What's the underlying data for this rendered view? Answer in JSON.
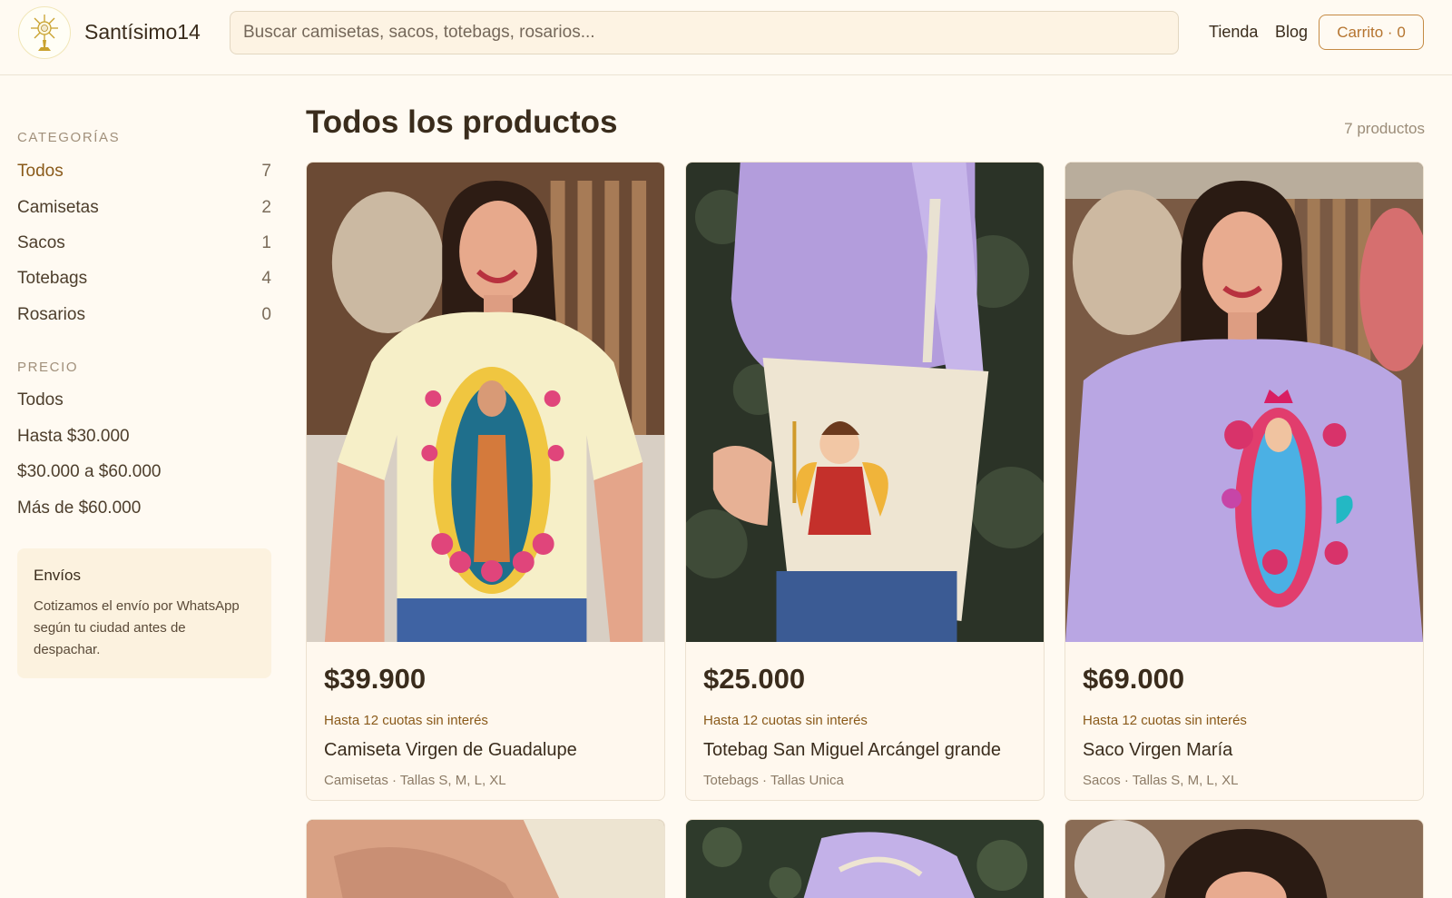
{
  "header": {
    "brand": "Santísimo14",
    "search_placeholder": "Buscar camisetas, sacos, totebags, rosarios...",
    "nav": [
      "Tienda",
      "Blog"
    ],
    "cart_label": "Carrito · 0",
    "logo_icon": "monstrance-icon"
  },
  "sidebar": {
    "categories_heading": "CATEGORÍAS",
    "categories": [
      {
        "label": "Todos",
        "count": "7",
        "active": true
      },
      {
        "label": "Camisetas",
        "count": "2"
      },
      {
        "label": "Sacos",
        "count": "1"
      },
      {
        "label": "Totebags",
        "count": "4"
      },
      {
        "label": "Rosarios",
        "count": "0"
      }
    ],
    "price_heading": "PRECIO",
    "price_filters": [
      "Todos",
      "Hasta $30.000",
      "$30.000 a $60.000",
      "Más de $60.000"
    ],
    "shipping": {
      "title": "Envíos",
      "text": "Cotizamos el envío por WhatsApp según tu ciudad antes de despachar."
    }
  },
  "main": {
    "title": "Todos los productos",
    "count": "7 productos",
    "products": [
      {
        "price": "$39.900",
        "installments": "Hasta 12 cuotas sin interés",
        "name": "Camiseta Virgen de Guadalupe",
        "meta": "Camisetas · Tallas S, M, L, XL",
        "image": "model-cream-tshirt-guadalupe"
      },
      {
        "price": "$25.000",
        "installments": "Hasta 12 cuotas sin interés",
        "name": "Totebag San Miguel Arcángel grande",
        "meta": "Totebags · Tallas Unica",
        "image": "model-tote-san-miguel"
      },
      {
        "price": "$69.000",
        "installments": "Hasta 12 cuotas sin interés",
        "name": "Saco Virgen María",
        "meta": "Sacos · Tallas S, M, L, XL",
        "image": "model-lilac-sweater-virgen"
      }
    ]
  },
  "colors": {
    "background": "#fffaf2",
    "accent": "#b5742f",
    "text": "#3a2c1c"
  }
}
